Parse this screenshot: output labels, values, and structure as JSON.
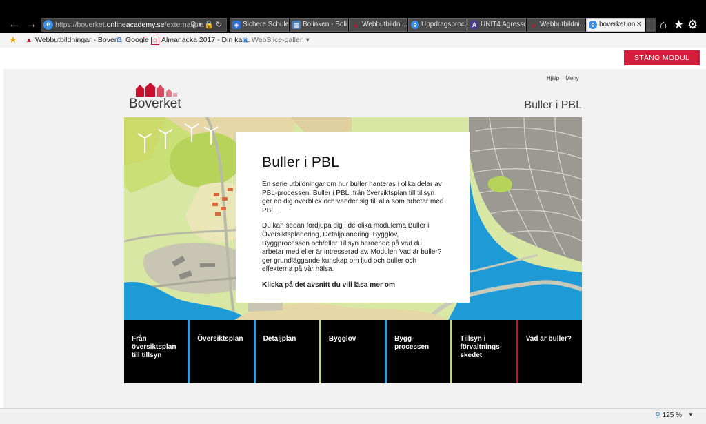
{
  "browser": {
    "address": {
      "url_prefix": "https://boverket.",
      "url_domain": "onlineacademy.se",
      "url_rest": "/external/pla"
    },
    "tabs": [
      {
        "label": "Sichere Schule ...",
        "icon": "shield-icon",
        "color": "#2a6fcf"
      },
      {
        "label": "Bolinken - Boli...",
        "icon": "page-icon",
        "color": "#4a7cc0"
      },
      {
        "label": "Webbutbildni...",
        "icon": "boverket-icon",
        "color": "#c8102e"
      },
      {
        "label": "Uppdragsproc...",
        "icon": "ie-icon",
        "color": "#3a8ee6"
      },
      {
        "label": "UNIT4 Agresso",
        "icon": "agresso-icon",
        "color": "#4a3c8c"
      },
      {
        "label": "Webbutbildni...",
        "icon": "boverket-icon",
        "color": "#c8102e"
      },
      {
        "label": "boverket.on...",
        "icon": "ie-icon",
        "color": "#3a8ee6",
        "active": true
      }
    ],
    "favorites": [
      {
        "label": "Webbutbildningar - Bover...",
        "icon": "boverket-icon"
      },
      {
        "label": "Google",
        "icon": "google-icon"
      },
      {
        "label": "Almanacka 2017 - Din kal...",
        "icon": "calendar-icon"
      },
      {
        "label": "WebSlice-galleri",
        "icon": "webslice-icon"
      }
    ],
    "zoom": "125 %"
  },
  "page": {
    "close_module": "STÄNG MODUL",
    "help": "Hjälp",
    "menu": "Meny",
    "logo": "Boverket",
    "header_title": "Buller i PBL",
    "intro": {
      "title": "Buller i PBL",
      "p1": "En serie utbildningar om hur buller hanteras i olika delar av PBL-processen. Buller i PBL: från översiktsplan till tillsyn ger en dig överblick och vänder sig till alla som arbetar med PBL.",
      "p2": "Du kan sedan fördjupa dig i de olika modulerna Buller i Översiktsplanering, Detaljplanering, Bygglov, Byggprocessen och/eller Tillsyn beroende på vad du arbetar med eller är intresserad av. Modulen Vad är buller? ger grundläggande kunskap om ljud och buller och effekterna på vår hälsa.",
      "cta": "Klicka på det avsnitt du vill läsa mer om"
    },
    "modules": [
      {
        "label": "Från\növersiktsplan\ntill tillsyn",
        "accent": "#2a9fd6"
      },
      {
        "label": "Översiktsplan",
        "accent": "#2a9fd6"
      },
      {
        "label": "Detaljplan",
        "accent": "#b9d96a"
      },
      {
        "label": "Bygglov",
        "accent": "#2a9fd6"
      },
      {
        "label": "Bygg-\nprocessen",
        "accent": "#b9d96a"
      },
      {
        "label": "Tillsyn i\nförvaltnings-\nskedet",
        "accent": "#c8102e"
      },
      {
        "label": "Vad är buller?",
        "accent": "#000000"
      }
    ]
  },
  "colors": {
    "brand_red": "#d31f3c",
    "water": "#1e9bd7",
    "land": "#d9e7a4",
    "city": "#9a9a93"
  }
}
